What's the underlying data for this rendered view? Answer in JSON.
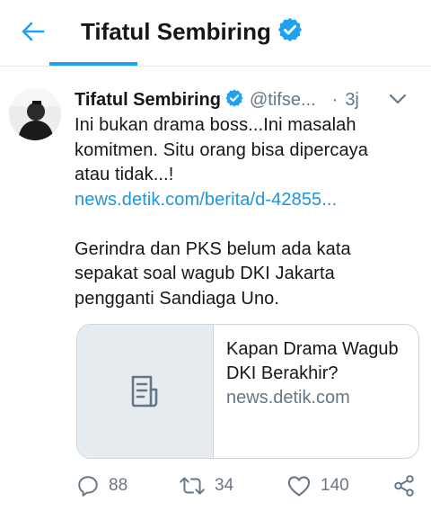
{
  "header": {
    "title": "Tifatul Sembiring",
    "back_icon": "arrow-left-icon",
    "verified_icon": "verified-badge-icon",
    "accent_color": "#1da1f2"
  },
  "tweet": {
    "author_name": "Tifatul Sembiring",
    "handle": "@tifse...",
    "dot": "·",
    "time": "3j",
    "text_lines": [
      "Ini bukan drama boss...Ini masalah",
      "komitmen. Situ orang bisa dipercaya",
      "atau tidak...!"
    ],
    "link_text": "news.detik.com/berita/d-42855...",
    "text_lines_2": [
      "Gerindra dan PKS belum ada kata",
      "sepakat soal wagub DKI Jakarta",
      "pengganti Sandiaga Uno."
    ],
    "link_color": "#1b95e0"
  },
  "card": {
    "title_line_1": "Kapan Drama Wagub",
    "title_line_2": "DKI Berakhir?",
    "domain": "news.detik.com",
    "thumb_icon": "document-icon"
  },
  "actions": {
    "reply_count": "88",
    "retweet_count": "34",
    "like_count": "140",
    "reply_icon": "reply-icon",
    "retweet_icon": "retweet-icon",
    "like_icon": "heart-icon",
    "share_icon": "share-icon"
  }
}
